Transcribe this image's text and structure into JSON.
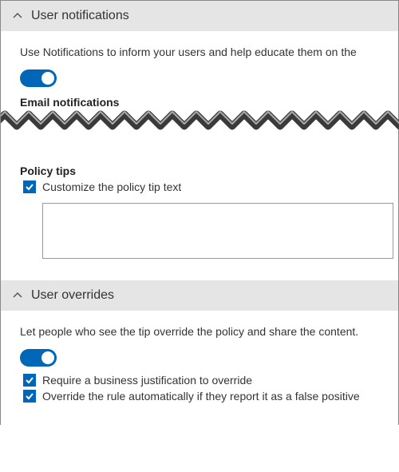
{
  "notifications": {
    "header": "User notifications",
    "description": "Use Notifications to inform your users and help educate them on the",
    "email_label": "Email notifications",
    "policy_tips_label": "Policy tips",
    "customize_tip_label": "Customize the policy tip text",
    "customize_tip_value": "",
    "toggle_on": true,
    "customize_checked": true
  },
  "overrides": {
    "header": "User overrides",
    "description": "Let people who see the tip override the policy and share the content.",
    "toggle_on": true,
    "require_justification_label": "Require a business justification to override",
    "false_positive_label": "Override the rule automatically if they report it as a false positive",
    "require_justification_checked": true,
    "false_positive_checked": true
  }
}
